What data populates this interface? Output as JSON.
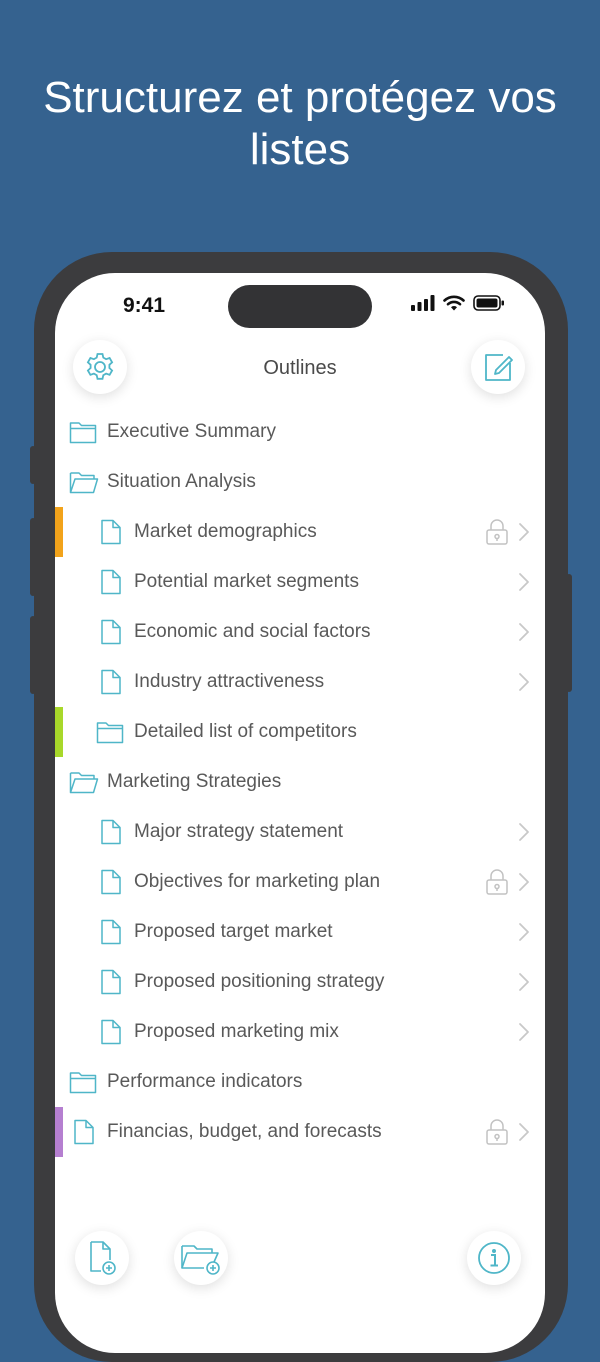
{
  "headline": "Structurez et protégez vos listes",
  "status": {
    "time": "9:41"
  },
  "nav": {
    "title": "Outlines",
    "settings_icon": "gear-icon",
    "edit_icon": "compose-icon"
  },
  "colors": {
    "background": "#35628f",
    "accent": "#4fb6c8",
    "tag_orange": "#f2a31b",
    "tag_green": "#a8d82a",
    "tag_purple": "#b57fd0"
  },
  "items": [
    {
      "label": "Executive Summary",
      "type": "folder-closed",
      "level": 0,
      "locked": false,
      "chevron": false,
      "tag": null
    },
    {
      "label": "Situation Analysis",
      "type": "folder-open",
      "level": 0,
      "locked": false,
      "chevron": false,
      "tag": null
    },
    {
      "label": "Market demographics",
      "type": "document",
      "level": 1,
      "locked": true,
      "chevron": true,
      "tag": "#f2a31b"
    },
    {
      "label": "Potential market segments",
      "type": "document",
      "level": 1,
      "locked": false,
      "chevron": true,
      "tag": null
    },
    {
      "label": "Economic and social factors",
      "type": "document",
      "level": 1,
      "locked": false,
      "chevron": true,
      "tag": null
    },
    {
      "label": "Industry attractiveness",
      "type": "document",
      "level": 1,
      "locked": false,
      "chevron": true,
      "tag": null
    },
    {
      "label": "Detailed list of competitors",
      "type": "folder-closed",
      "level": 1,
      "locked": false,
      "chevron": false,
      "tag": "#a8d82a"
    },
    {
      "label": "Marketing Strategies",
      "type": "folder-open",
      "level": 0,
      "locked": false,
      "chevron": false,
      "tag": null
    },
    {
      "label": "Major strategy statement",
      "type": "document",
      "level": 1,
      "locked": false,
      "chevron": true,
      "tag": null
    },
    {
      "label": "Objectives for marketing plan",
      "type": "document",
      "level": 1,
      "locked": true,
      "chevron": true,
      "tag": null
    },
    {
      "label": "Proposed target market",
      "type": "document",
      "level": 1,
      "locked": false,
      "chevron": true,
      "tag": null
    },
    {
      "label": "Proposed positioning strategy",
      "type": "document",
      "level": 1,
      "locked": false,
      "chevron": true,
      "tag": null
    },
    {
      "label": "Proposed marketing mix",
      "type": "document",
      "level": 1,
      "locked": false,
      "chevron": true,
      "tag": null
    },
    {
      "label": "Performance indicators",
      "type": "folder-closed",
      "level": 0,
      "locked": false,
      "chevron": false,
      "tag": null
    },
    {
      "label": "Financias, budget, and forecasts",
      "type": "document",
      "level": 0,
      "locked": true,
      "chevron": true,
      "tag": "#b57fd0"
    }
  ],
  "toolbar": {
    "new_document_icon": "new-document-icon",
    "new_folder_icon": "new-folder-icon",
    "info_icon": "info-icon"
  }
}
